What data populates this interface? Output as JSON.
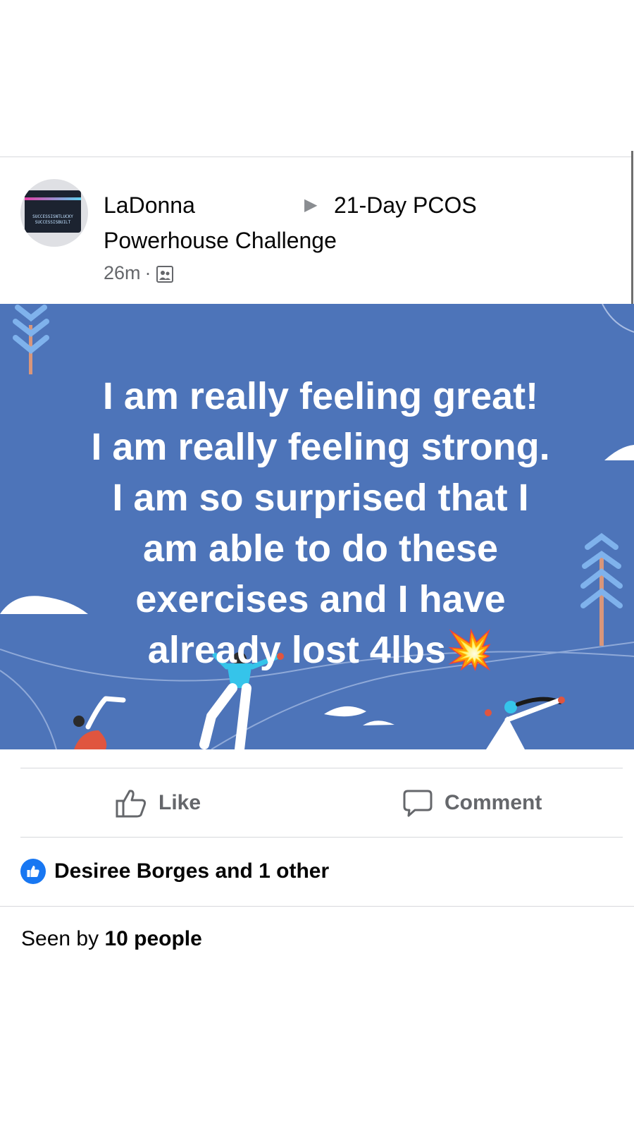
{
  "post": {
    "author": "LaDonna",
    "group_line1": "21-Day PCOS",
    "group_line2": "Powerhouse Challenge",
    "time": "26m",
    "separator": "·",
    "audience_icon": "group-members-icon",
    "avatar_text": [
      "SUCCESSISNTLUCKY",
      "SUCCESSISBUILT"
    ],
    "background_color": "#4d74b9",
    "text_lines": [
      "I am really feeling great!",
      "I am really feeling strong.",
      "I am so surprised that I",
      "am able to do these",
      "exercises and I have",
      "already lost 4lbs💥"
    ]
  },
  "actions": {
    "like_label": "Like",
    "comment_label": "Comment"
  },
  "reactions": {
    "summary": "Desiree Borges and 1 other"
  },
  "seen": {
    "prefix": "Seen by",
    "count_text": "10 people"
  },
  "colors": {
    "accent": "#1877f2",
    "secondary_text": "#65676b",
    "card_bg": "#4d74b9"
  }
}
